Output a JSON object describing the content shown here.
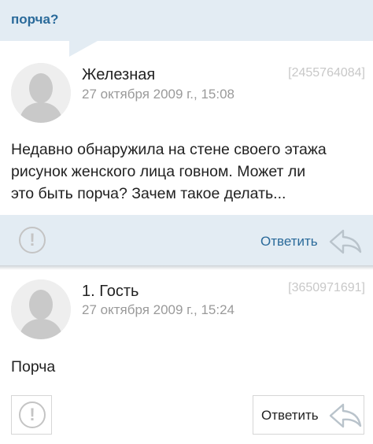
{
  "topbar": {
    "title": "порча?"
  },
  "comments": [
    {
      "author": "Железная",
      "date": "27 октября 2009 г., 15:08",
      "id": "[2455764084]",
      "lines": [
        "Недавно обнаружила на стене своего этажа",
        "рисунок женского лица говном. Может ли",
        "это быть порча? Зачем такое делать..."
      ],
      "reply_label": "Ответить",
      "alert_glyph": "!"
    },
    {
      "author": "1. Гость",
      "date": "27 октября 2009 г., 15:24",
      "id": "[3650971691]",
      "lines": [
        "Порча"
      ],
      "reply_label": "Ответить",
      "alert_glyph": "!"
    }
  ],
  "colors": {
    "accent": "#2a6a9a",
    "band": "#e3ecf3",
    "muted": "#9a9a9a"
  },
  "icons": [
    "user-avatar-icon",
    "report-alert-icon",
    "reply-arrow-icon"
  ]
}
